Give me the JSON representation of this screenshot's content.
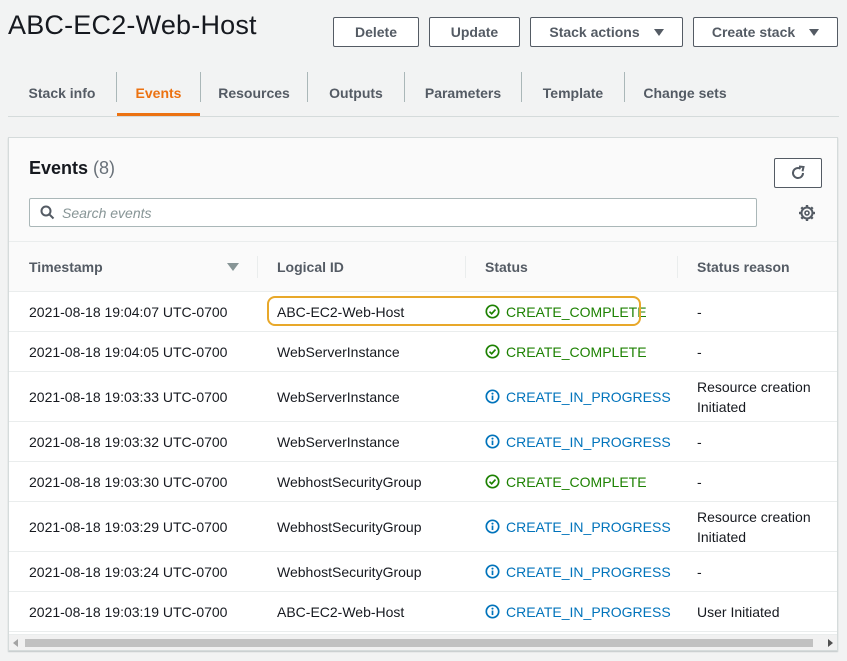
{
  "header": {
    "title": "ABC-EC2-Web-Host",
    "buttons": {
      "delete": "Delete",
      "update": "Update",
      "stack_actions": "Stack actions",
      "create_stack": "Create stack"
    }
  },
  "tabs": [
    {
      "label": "Stack info",
      "active": false
    },
    {
      "label": "Events",
      "active": true
    },
    {
      "label": "Resources",
      "active": false
    },
    {
      "label": "Outputs",
      "active": false
    },
    {
      "label": "Parameters",
      "active": false
    },
    {
      "label": "Template",
      "active": false
    },
    {
      "label": "Change sets",
      "active": false
    }
  ],
  "events": {
    "title": "Events",
    "count": "(8)",
    "search_placeholder": "Search events",
    "columns": {
      "timestamp": "Timestamp",
      "logical_id": "Logical ID",
      "status": "Status",
      "status_reason": "Status reason"
    },
    "rows": [
      {
        "timestamp": "2021-08-18 19:04:07 UTC-0700",
        "logical_id": "ABC-EC2-Web-Host",
        "status": "CREATE_COMPLETE",
        "status_type": "complete",
        "reason_1": "-",
        "reason_2": ""
      },
      {
        "timestamp": "2021-08-18 19:04:05 UTC-0700",
        "logical_id": "WebServerInstance",
        "status": "CREATE_COMPLETE",
        "status_type": "complete",
        "reason_1": "-",
        "reason_2": ""
      },
      {
        "timestamp": "2021-08-18 19:03:33 UTC-0700",
        "logical_id": "WebServerInstance",
        "status": "CREATE_IN_PROGRESS",
        "status_type": "progress",
        "reason_1": "Resource creation",
        "reason_2": "Initiated"
      },
      {
        "timestamp": "2021-08-18 19:03:32 UTC-0700",
        "logical_id": "WebServerInstance",
        "status": "CREATE_IN_PROGRESS",
        "status_type": "progress",
        "reason_1": "-",
        "reason_2": ""
      },
      {
        "timestamp": "2021-08-18 19:03:30 UTC-0700",
        "logical_id": "WebhostSecurityGroup",
        "status": "CREATE_COMPLETE",
        "status_type": "complete",
        "reason_1": "-",
        "reason_2": ""
      },
      {
        "timestamp": "2021-08-18 19:03:29 UTC-0700",
        "logical_id": "WebhostSecurityGroup",
        "status": "CREATE_IN_PROGRESS",
        "status_type": "progress",
        "reason_1": "Resource creation",
        "reason_2": "Initiated"
      },
      {
        "timestamp": "2021-08-18 19:03:24 UTC-0700",
        "logical_id": "WebhostSecurityGroup",
        "status": "CREATE_IN_PROGRESS",
        "status_type": "progress",
        "reason_1": "-",
        "reason_2": ""
      },
      {
        "timestamp": "2021-08-18 19:03:19 UTC-0700",
        "logical_id": "ABC-EC2-Web-Host",
        "status": "CREATE_IN_PROGRESS",
        "status_type": "progress",
        "reason_1": "User Initiated",
        "reason_2": ""
      }
    ]
  },
  "colors": {
    "accent": "#ec7211",
    "complete": "#1d8102",
    "progress": "#0073bb",
    "highlight": "#e8a82a"
  },
  "icons": {
    "search": "search-icon",
    "refresh": "refresh-icon",
    "settings": "gear-icon",
    "complete": "check-circle-icon",
    "progress": "info-circle-icon",
    "sort": "sort-caret-icon"
  }
}
